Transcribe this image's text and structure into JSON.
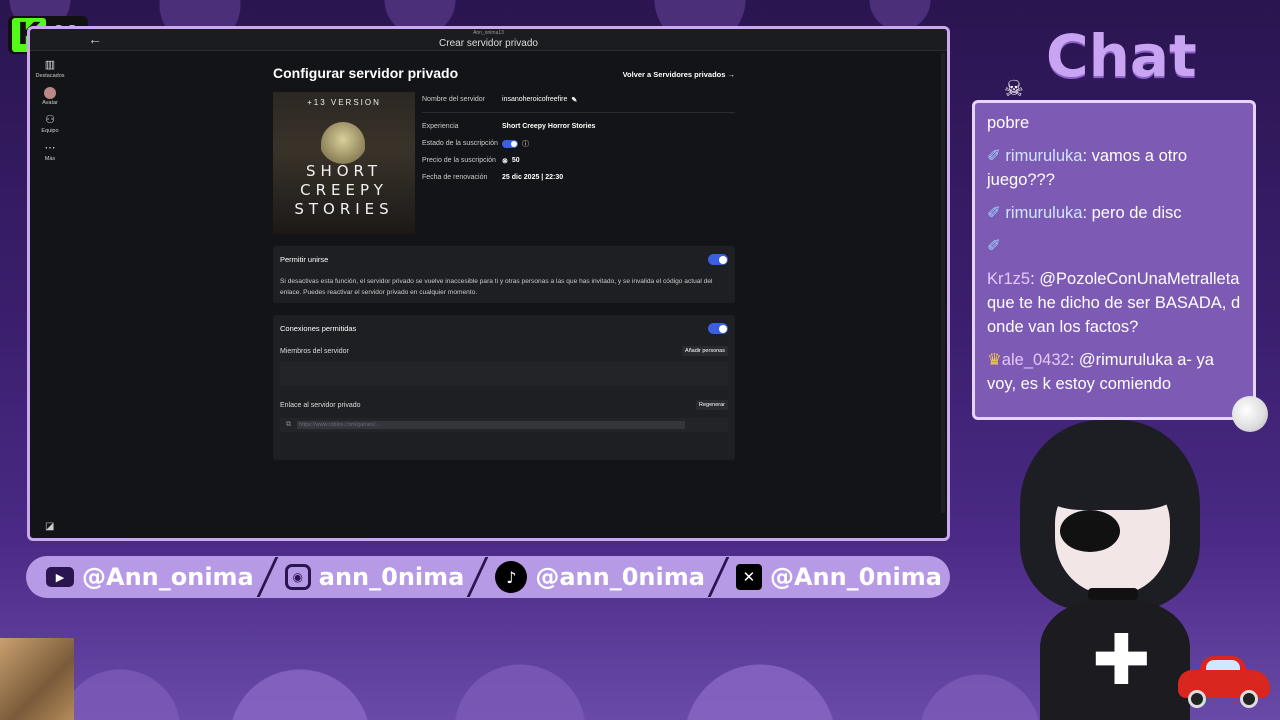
{
  "stream": {
    "kick_viewers": "22",
    "chat_title": "Chat",
    "socials": [
      {
        "icon": "youtube-icon",
        "handle": "@Ann_onima"
      },
      {
        "icon": "instagram-icon",
        "handle": "ann_0nima"
      },
      {
        "icon": "tiktok-icon",
        "handle": "@ann_0nima"
      },
      {
        "icon": "x-icon",
        "handle": "@Ann_0nima"
      }
    ]
  },
  "chat": {
    "messages": [
      {
        "user": "",
        "text": "pobre"
      },
      {
        "user": "rimuruluka",
        "text": "vamos a otro juego???"
      },
      {
        "user": "rimuruluka",
        "text": "pero de disc"
      },
      {
        "user": "",
        "text": ""
      },
      {
        "user": "Kr1z5",
        "text": "@PozoleConUnaMetralleta que te he dicho de ser BASADA, donde van los factos?"
      },
      {
        "user": "ale_0432",
        "text": "@rimuruluka a- ya voy, es k estoy comiendo"
      }
    ]
  },
  "window": {
    "title_small": "Ann_onima13",
    "title": "Crear servidor privado",
    "sidebar": [
      {
        "icon": "chart-icon",
        "label": "Destacados"
      },
      {
        "icon": "avatar-icon",
        "label": "Avatar"
      },
      {
        "icon": "team-icon",
        "label": "Equipo"
      },
      {
        "icon": "more-icon",
        "label": "Más"
      }
    ]
  },
  "page": {
    "heading": "Configurar servidor privado",
    "back_link": "Volver a Servidores privados →",
    "cover": {
      "version": "+13 VERSION",
      "title_line1": "SHORT",
      "title_line2": "CREEPY",
      "title_line3": "STORIES"
    },
    "details": {
      "server_name_label": "Nombre del servidor",
      "server_name": "insanoheroicofreefire",
      "experience_label": "Experiencia",
      "experience": "Short Creepy Horror Stories",
      "subscription_label": "Estado de la suscripción",
      "subscription_on": true,
      "price_label": "Precio de la suscripción",
      "price": "50",
      "renewal_label": "Fecha de renovación",
      "renewal": "25 dic 2025 | 22:30"
    },
    "allow_join": {
      "label": "Permitir unirse",
      "enabled": true,
      "description": "Si desactivas esta función, el servidor privado se vuelve inaccesible para ti y otras personas a las que has invitado, y se invalida el código actual del enlace. Puedes reactivar el servidor privado en cualquier momento."
    },
    "connections": {
      "label": "Conexiones permitidas",
      "enabled": true,
      "members_label": "Miembros del servidor",
      "add_button": "Añadir personas",
      "link_label": "Enlace al servidor privado",
      "regen_button": "Regenerar",
      "link_value": "https://www.roblox.com/games/..."
    }
  },
  "colors": {
    "accent_toggle": "#3a5fe0",
    "frame_border": "#c9a8f0",
    "kick_green": "#53fc18"
  }
}
